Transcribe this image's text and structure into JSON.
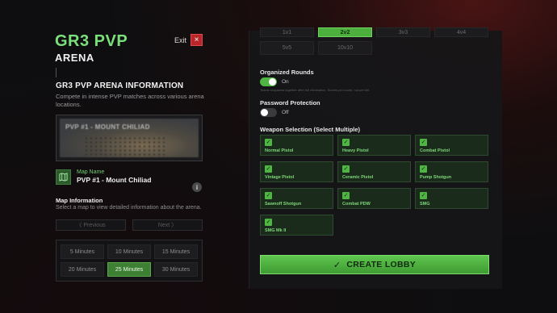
{
  "header": {
    "title": "GR3 PVP",
    "subtitle": "ARENA",
    "exit_label": "Exit",
    "exit_icon": "×"
  },
  "info": {
    "title": "GR3 PVP ARENA INFORMATION",
    "description": "Compete in intense PVP matches across various arena locations."
  },
  "map": {
    "preview_label": "PVP #1 - MOUNT CHILIAD",
    "name_label": "Map Name",
    "name_value": "PVP #1 - Mount Chiliad",
    "info_title": "Map Information",
    "info_desc": "Select a map to view detailed information about the arena.",
    "prev_label": "〈 Previous",
    "next_label": "Next 〉"
  },
  "durations": [
    {
      "label": "5 Minutes",
      "active": false
    },
    {
      "label": "10 Minutes",
      "active": false
    },
    {
      "label": "15 Minutes",
      "active": false
    },
    {
      "label": "20 Minutes",
      "active": false
    },
    {
      "label": "25 Minutes",
      "active": true
    },
    {
      "label": "30 Minutes",
      "active": false
    }
  ],
  "modes": [
    {
      "label": "1v1",
      "active": false
    },
    {
      "label": "2v2",
      "active": true
    },
    {
      "label": "3v3",
      "active": false
    },
    {
      "label": "4v4",
      "active": false
    },
    {
      "label": "5v5",
      "active": false
    },
    {
      "label": "10v10",
      "active": false
    }
  ],
  "organized_rounds": {
    "title": "Organized Rounds",
    "state": "On",
    "on": true,
    "note": "Teams respawns together after full elimination. Scores per round, not per kill."
  },
  "password_protection": {
    "title": "Password Protection",
    "state": "Off",
    "on": false
  },
  "weapons": {
    "title": "Weapon Selection (Select Multiple)",
    "items": [
      {
        "label": "Normal Pistol",
        "checked": true
      },
      {
        "label": "Heavy Pistol",
        "checked": true
      },
      {
        "label": "Combat Pistol",
        "checked": true
      },
      {
        "label": "Vintage Pistol",
        "checked": true
      },
      {
        "label": "Ceramic Pistol",
        "checked": true
      },
      {
        "label": "Pump Shotgun",
        "checked": true
      },
      {
        "label": "Sawnoff Shotgun",
        "checked": true
      },
      {
        "label": "Combat PDW",
        "checked": true
      },
      {
        "label": "SMG",
        "checked": true
      },
      {
        "label": "SMG Mk II",
        "checked": true
      }
    ]
  },
  "create_button": {
    "label": "CREATE LOBBY",
    "icon": "✓"
  },
  "colors": {
    "accent": "#4fb543",
    "brand_green": "#7be07b",
    "exit_red": "#b8262a"
  }
}
